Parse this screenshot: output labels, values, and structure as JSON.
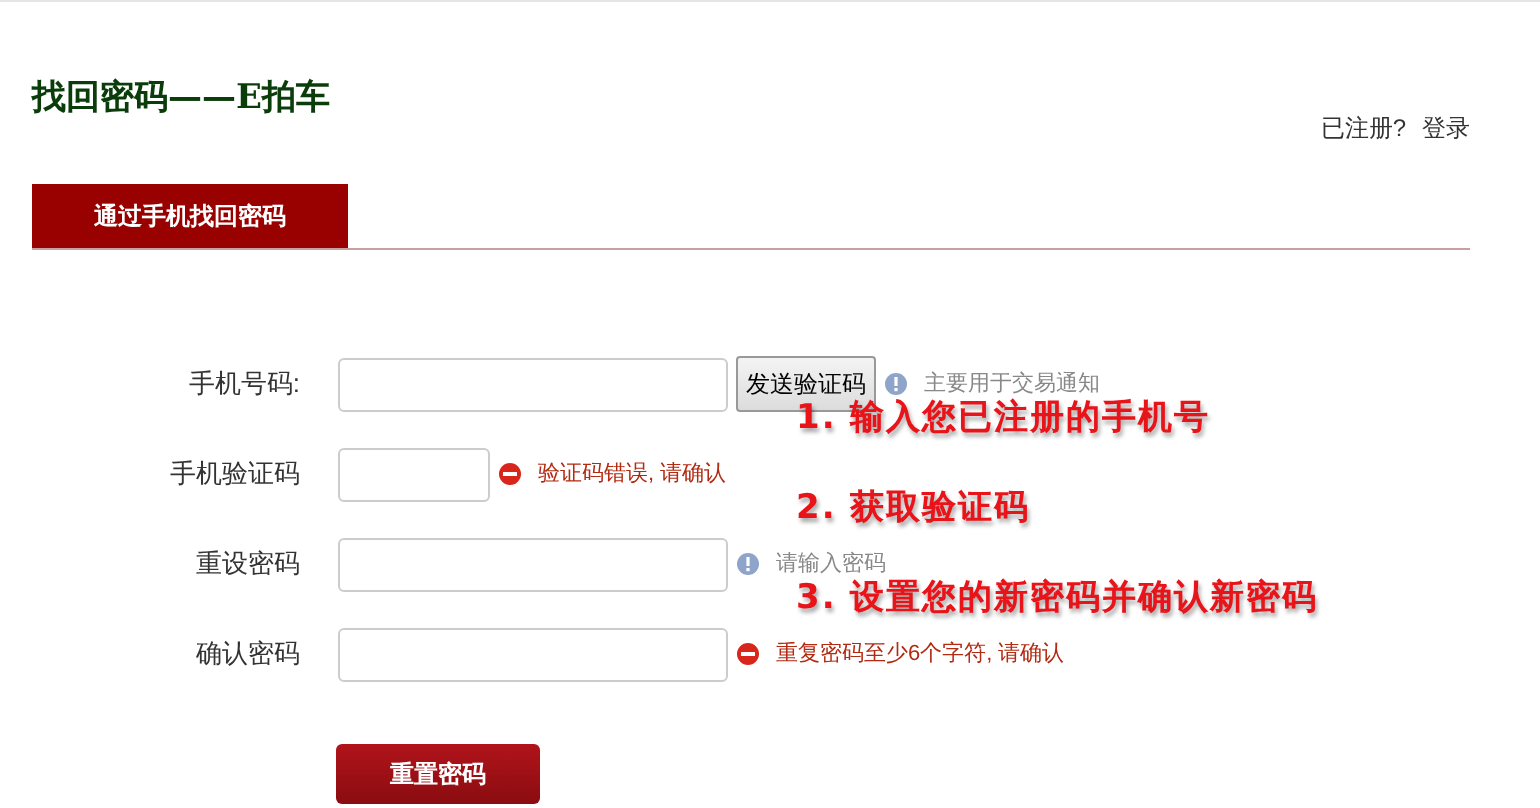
{
  "header": {
    "title": "找回密码——E拍车",
    "links": [
      "已注册?",
      "登录"
    ]
  },
  "tabs": [
    {
      "label": "通过手机找回密码",
      "selected": true
    }
  ],
  "fields": [
    {
      "label": "手机号码:",
      "kind": "wide",
      "button": "发送验证码",
      "hint": {
        "kind": "info",
        "text": "主要用于交易通知"
      }
    },
    {
      "label": "手机验证码",
      "kind": "narrow",
      "hint": {
        "kind": "error",
        "text": "验证码错误, 请确认"
      }
    },
    {
      "label": "重设密码",
      "kind": "wide",
      "hint": {
        "kind": "info",
        "text": "请输入密码"
      }
    },
    {
      "label": "确认密码",
      "kind": "wide",
      "hint": {
        "kind": "error",
        "text": "重复密码至少6个字符, 请确认"
      }
    }
  ],
  "submit": "重置密码",
  "annotations": [
    "1. 输入您已注册的手机号",
    "2. 获取验证码",
    "3. 设置您的新密码并确认新密码"
  ]
}
